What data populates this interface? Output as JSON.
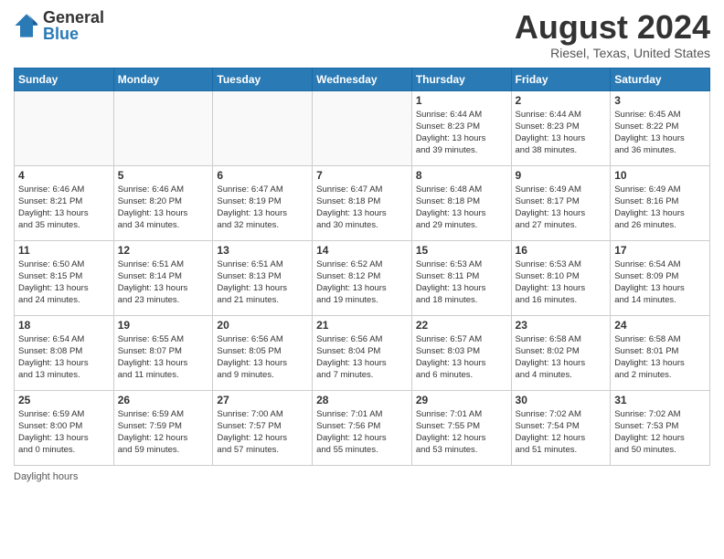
{
  "header": {
    "logo_general": "General",
    "logo_blue": "Blue",
    "title": "August 2024",
    "subtitle": "Riesel, Texas, United States"
  },
  "days_of_week": [
    "Sunday",
    "Monday",
    "Tuesday",
    "Wednesday",
    "Thursday",
    "Friday",
    "Saturday"
  ],
  "weeks": [
    [
      {
        "day": "",
        "info": ""
      },
      {
        "day": "",
        "info": ""
      },
      {
        "day": "",
        "info": ""
      },
      {
        "day": "",
        "info": ""
      },
      {
        "day": "1",
        "info": "Sunrise: 6:44 AM\nSunset: 8:23 PM\nDaylight: 13 hours\nand 39 minutes."
      },
      {
        "day": "2",
        "info": "Sunrise: 6:44 AM\nSunset: 8:23 PM\nDaylight: 13 hours\nand 38 minutes."
      },
      {
        "day": "3",
        "info": "Sunrise: 6:45 AM\nSunset: 8:22 PM\nDaylight: 13 hours\nand 36 minutes."
      }
    ],
    [
      {
        "day": "4",
        "info": "Sunrise: 6:46 AM\nSunset: 8:21 PM\nDaylight: 13 hours\nand 35 minutes."
      },
      {
        "day": "5",
        "info": "Sunrise: 6:46 AM\nSunset: 8:20 PM\nDaylight: 13 hours\nand 34 minutes."
      },
      {
        "day": "6",
        "info": "Sunrise: 6:47 AM\nSunset: 8:19 PM\nDaylight: 13 hours\nand 32 minutes."
      },
      {
        "day": "7",
        "info": "Sunrise: 6:47 AM\nSunset: 8:18 PM\nDaylight: 13 hours\nand 30 minutes."
      },
      {
        "day": "8",
        "info": "Sunrise: 6:48 AM\nSunset: 8:18 PM\nDaylight: 13 hours\nand 29 minutes."
      },
      {
        "day": "9",
        "info": "Sunrise: 6:49 AM\nSunset: 8:17 PM\nDaylight: 13 hours\nand 27 minutes."
      },
      {
        "day": "10",
        "info": "Sunrise: 6:49 AM\nSunset: 8:16 PM\nDaylight: 13 hours\nand 26 minutes."
      }
    ],
    [
      {
        "day": "11",
        "info": "Sunrise: 6:50 AM\nSunset: 8:15 PM\nDaylight: 13 hours\nand 24 minutes."
      },
      {
        "day": "12",
        "info": "Sunrise: 6:51 AM\nSunset: 8:14 PM\nDaylight: 13 hours\nand 23 minutes."
      },
      {
        "day": "13",
        "info": "Sunrise: 6:51 AM\nSunset: 8:13 PM\nDaylight: 13 hours\nand 21 minutes."
      },
      {
        "day": "14",
        "info": "Sunrise: 6:52 AM\nSunset: 8:12 PM\nDaylight: 13 hours\nand 19 minutes."
      },
      {
        "day": "15",
        "info": "Sunrise: 6:53 AM\nSunset: 8:11 PM\nDaylight: 13 hours\nand 18 minutes."
      },
      {
        "day": "16",
        "info": "Sunrise: 6:53 AM\nSunset: 8:10 PM\nDaylight: 13 hours\nand 16 minutes."
      },
      {
        "day": "17",
        "info": "Sunrise: 6:54 AM\nSunset: 8:09 PM\nDaylight: 13 hours\nand 14 minutes."
      }
    ],
    [
      {
        "day": "18",
        "info": "Sunrise: 6:54 AM\nSunset: 8:08 PM\nDaylight: 13 hours\nand 13 minutes."
      },
      {
        "day": "19",
        "info": "Sunrise: 6:55 AM\nSunset: 8:07 PM\nDaylight: 13 hours\nand 11 minutes."
      },
      {
        "day": "20",
        "info": "Sunrise: 6:56 AM\nSunset: 8:05 PM\nDaylight: 13 hours\nand 9 minutes."
      },
      {
        "day": "21",
        "info": "Sunrise: 6:56 AM\nSunset: 8:04 PM\nDaylight: 13 hours\nand 7 minutes."
      },
      {
        "day": "22",
        "info": "Sunrise: 6:57 AM\nSunset: 8:03 PM\nDaylight: 13 hours\nand 6 minutes."
      },
      {
        "day": "23",
        "info": "Sunrise: 6:58 AM\nSunset: 8:02 PM\nDaylight: 13 hours\nand 4 minutes."
      },
      {
        "day": "24",
        "info": "Sunrise: 6:58 AM\nSunset: 8:01 PM\nDaylight: 13 hours\nand 2 minutes."
      }
    ],
    [
      {
        "day": "25",
        "info": "Sunrise: 6:59 AM\nSunset: 8:00 PM\nDaylight: 13 hours\nand 0 minutes."
      },
      {
        "day": "26",
        "info": "Sunrise: 6:59 AM\nSunset: 7:59 PM\nDaylight: 12 hours\nand 59 minutes."
      },
      {
        "day": "27",
        "info": "Sunrise: 7:00 AM\nSunset: 7:57 PM\nDaylight: 12 hours\nand 57 minutes."
      },
      {
        "day": "28",
        "info": "Sunrise: 7:01 AM\nSunset: 7:56 PM\nDaylight: 12 hours\nand 55 minutes."
      },
      {
        "day": "29",
        "info": "Sunrise: 7:01 AM\nSunset: 7:55 PM\nDaylight: 12 hours\nand 53 minutes."
      },
      {
        "day": "30",
        "info": "Sunrise: 7:02 AM\nSunset: 7:54 PM\nDaylight: 12 hours\nand 51 minutes."
      },
      {
        "day": "31",
        "info": "Sunrise: 7:02 AM\nSunset: 7:53 PM\nDaylight: 12 hours\nand 50 minutes."
      }
    ]
  ],
  "footer": {
    "daylight_label": "Daylight hours"
  }
}
